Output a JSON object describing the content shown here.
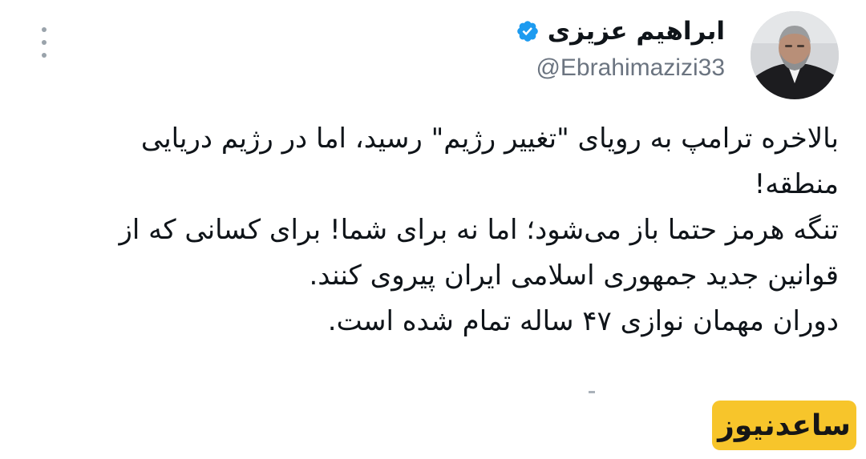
{
  "header": {
    "more_icon": "vertical-ellipsis-icon",
    "verified_icon": "verified-badge-icon",
    "verified_color": "#1d9bf0",
    "display_name": "ابراهیم عزیزی",
    "handle": "@Ebrahimazizi33"
  },
  "tweet": {
    "lines": [
      "بالاخره ترامپ به رویای \"تغییر رژیم\" رسید، اما در رژیم دریایی",
      "منطقه!",
      "تنگه هرمز حتما باز می‌شود؛ اما نه برای شما! برای کسانی که از",
      "قوانین جدید جمهوری اسلامی ایران پیروی کنند.",
      "دوران مهمان نوازی ۴۷ ساله تمام شده است."
    ]
  },
  "watermark": {
    "text": "ساعدنیوز",
    "background": "#f7c52b"
  }
}
